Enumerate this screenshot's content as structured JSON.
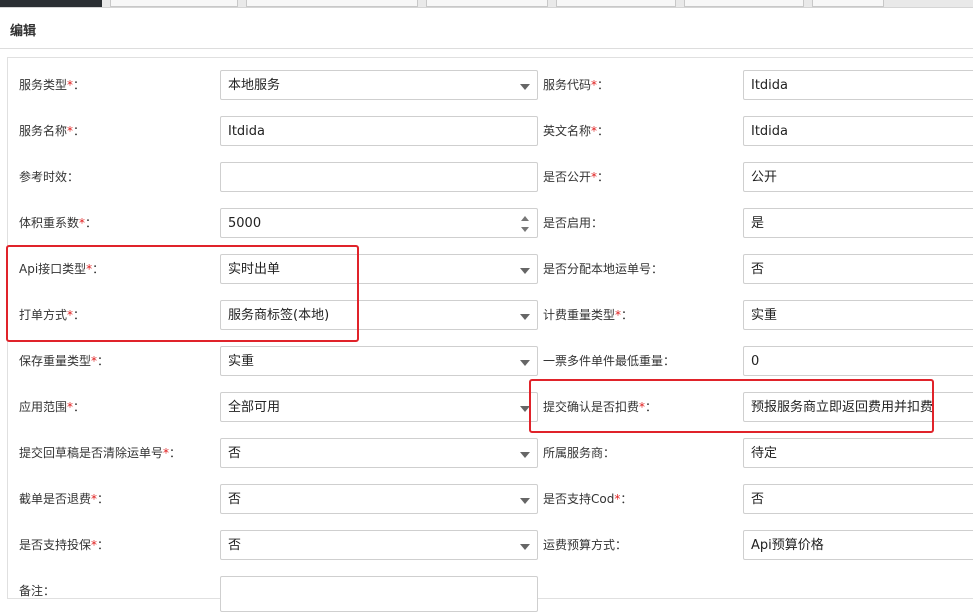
{
  "header": {
    "title": "编辑"
  },
  "required_mark": "*",
  "label_suffix": "：",
  "rows": [
    {
      "left": {
        "label": "服务类型",
        "required": true,
        "value": "本地服务",
        "control": "select"
      },
      "right": {
        "label": "服务代码",
        "required": true,
        "value": "Itdida",
        "control": "text"
      }
    },
    {
      "left": {
        "label": "服务名称",
        "required": true,
        "value": "Itdida",
        "control": "text"
      },
      "right": {
        "label": "英文名称",
        "required": true,
        "value": "Itdida",
        "control": "text"
      }
    },
    {
      "left": {
        "label": "参考时效",
        "required": false,
        "value": "",
        "control": "text"
      },
      "right": {
        "label": "是否公开",
        "required": true,
        "value": "公开",
        "control": "text"
      }
    },
    {
      "left": {
        "label": "体积重系数",
        "required": true,
        "value": "5000",
        "control": "number"
      },
      "right": {
        "label": "是否启用",
        "required": false,
        "value": "是",
        "control": "text"
      }
    },
    {
      "left": {
        "label": "Api接口类型",
        "required": true,
        "value": "实时出单",
        "control": "select"
      },
      "right": {
        "label": "是否分配本地运单号",
        "required": false,
        "value": "否",
        "control": "text"
      }
    },
    {
      "left": {
        "label": "打单方式",
        "required": true,
        "value": "服务商标签(本地)",
        "control": "select"
      },
      "right": {
        "label": "计费重量类型",
        "required": true,
        "value": "实重",
        "control": "text"
      }
    },
    {
      "left": {
        "label": "保存重量类型",
        "required": true,
        "value": "实重",
        "control": "select"
      },
      "right": {
        "label": "一票多件单件最低重量",
        "required": false,
        "value": "0",
        "control": "text"
      }
    },
    {
      "left": {
        "label": "应用范围",
        "required": true,
        "value": "全部可用",
        "control": "select"
      },
      "right": {
        "label": "提交确认是否扣费",
        "required": true,
        "value": "预报服务商立即返回费用并扣费",
        "control": "text"
      }
    },
    {
      "left": {
        "label": "提交回草稿是否清除运单号",
        "required": true,
        "value": "否",
        "control": "select"
      },
      "right": {
        "label": "所属服务商",
        "required": false,
        "value": "待定",
        "control": "text"
      }
    },
    {
      "left": {
        "label": "截单是否退费",
        "required": true,
        "value": "否",
        "control": "select"
      },
      "right": {
        "label": "是否支持Cod",
        "required": true,
        "value": "否",
        "control": "text"
      }
    },
    {
      "left": {
        "label": "是否支持投保",
        "required": true,
        "value": "否",
        "control": "select"
      },
      "right": {
        "label": "运费预算方式",
        "required": false,
        "value": "Api预算价格",
        "control": "text"
      }
    },
    {
      "left": {
        "label": "备注",
        "required": false,
        "value": "",
        "control": "textarea"
      }
    }
  ],
  "colors": {
    "highlight": "#e0232a",
    "required": "#e02020"
  }
}
